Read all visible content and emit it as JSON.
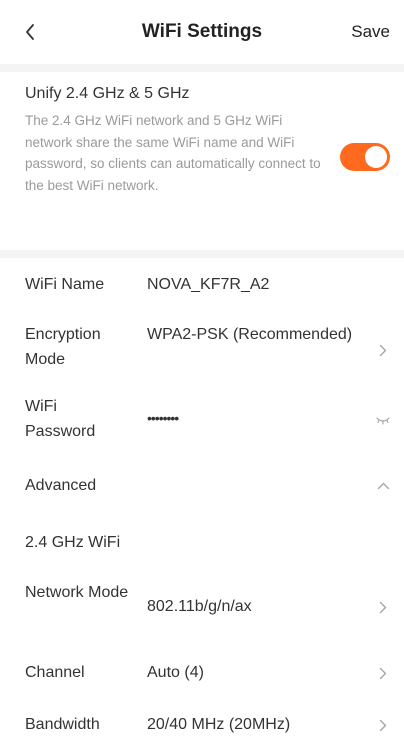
{
  "header": {
    "title": "WiFi Settings",
    "save_label": "Save",
    "back_icon": "chevron-left-icon"
  },
  "unify": {
    "title": "Unify 2.4 GHz & 5 GHz",
    "description": "The 2.4 GHz WiFi network and 5 GHz WiFi network share the same WiFi name and WiFi password, so clients can automatically connect to the best WiFi network.",
    "enabled": true
  },
  "wifi": {
    "name_label": "WiFi Name",
    "name_value": "NOVA_KF7R_A2",
    "encryption_label": "Encryption Mode",
    "encryption_value": "WPA2-PSK (Recommended)",
    "password_label": "WiFi Password",
    "password_value": "••••••••",
    "password_icon": "eye-closed-icon"
  },
  "advanced": {
    "label": "Advanced",
    "icon": "chevron-up-icon",
    "section_title": "2.4 GHz WiFi",
    "network_mode_label": "Network Mode",
    "network_mode_value": "802.11b/g/n/ax",
    "channel_label": "Channel",
    "channel_value": "Auto (4)",
    "bandwidth_label": "Bandwidth",
    "bandwidth_value": "20/40 MHz (20MHz)"
  },
  "colors": {
    "accent": "#ff6a1f",
    "text": "#333333",
    "muted": "#9a9a9a",
    "divider_bg": "#f4f4f4",
    "icon": "#a6a6a6"
  }
}
